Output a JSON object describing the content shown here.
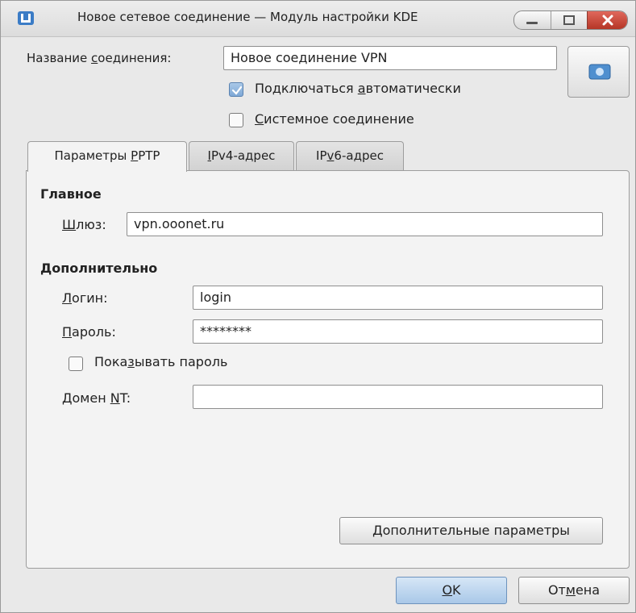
{
  "window": {
    "title": "Новое сетевое соединение — Модуль настройки KDE"
  },
  "connection_name": {
    "label_pre": "Название ",
    "label_u": "с",
    "label_post": "оединения:",
    "value": "Новое соединение VPN"
  },
  "auto_connect": {
    "label_pre": "Подключаться ",
    "label_u": "а",
    "label_post": "втоматически",
    "checked": true
  },
  "system_connection": {
    "label_pre": "",
    "label_u": "С",
    "label_post": "истемное соединение",
    "checked": false
  },
  "tabs": [
    {
      "pre": "Параметры ",
      "u": "P",
      "post": "PTP"
    },
    {
      "pre": "",
      "u": "I",
      "post": "Pv4-адрес"
    },
    {
      "pre": "IP",
      "u": "v",
      "post": "6-адрес"
    }
  ],
  "main_section": {
    "heading": "Главное",
    "gateway_label_pre": "",
    "gateway_label_u": "Ш",
    "gateway_label_post": "люз:",
    "gateway_value": "vpn.ooonet.ru"
  },
  "extra_section": {
    "heading": "Дополнительно",
    "login_label_pre": "",
    "login_label_u": "Л",
    "login_label_post": "огин:",
    "login_value": "login",
    "password_label_pre": "",
    "password_label_u": "П",
    "password_label_post": "ароль:",
    "password_value": "********",
    "show_password_pre": "Пока",
    "show_password_u": "з",
    "show_password_post": "ывать пароль",
    "show_password_checked": false,
    "domain_label_pre": "Домен ",
    "domain_label_u": "N",
    "domain_label_post": "T:",
    "domain_value": ""
  },
  "advanced_button": "Дополнительные параметры",
  "ok_button": {
    "u": "O",
    "post": "K"
  },
  "cancel_button": {
    "pre": "От",
    "u": "м",
    "post": "ена"
  },
  "colors": {
    "accent": "#a9c8e8",
    "close_button": "#c6483a",
    "background": "#e9e9e9"
  }
}
